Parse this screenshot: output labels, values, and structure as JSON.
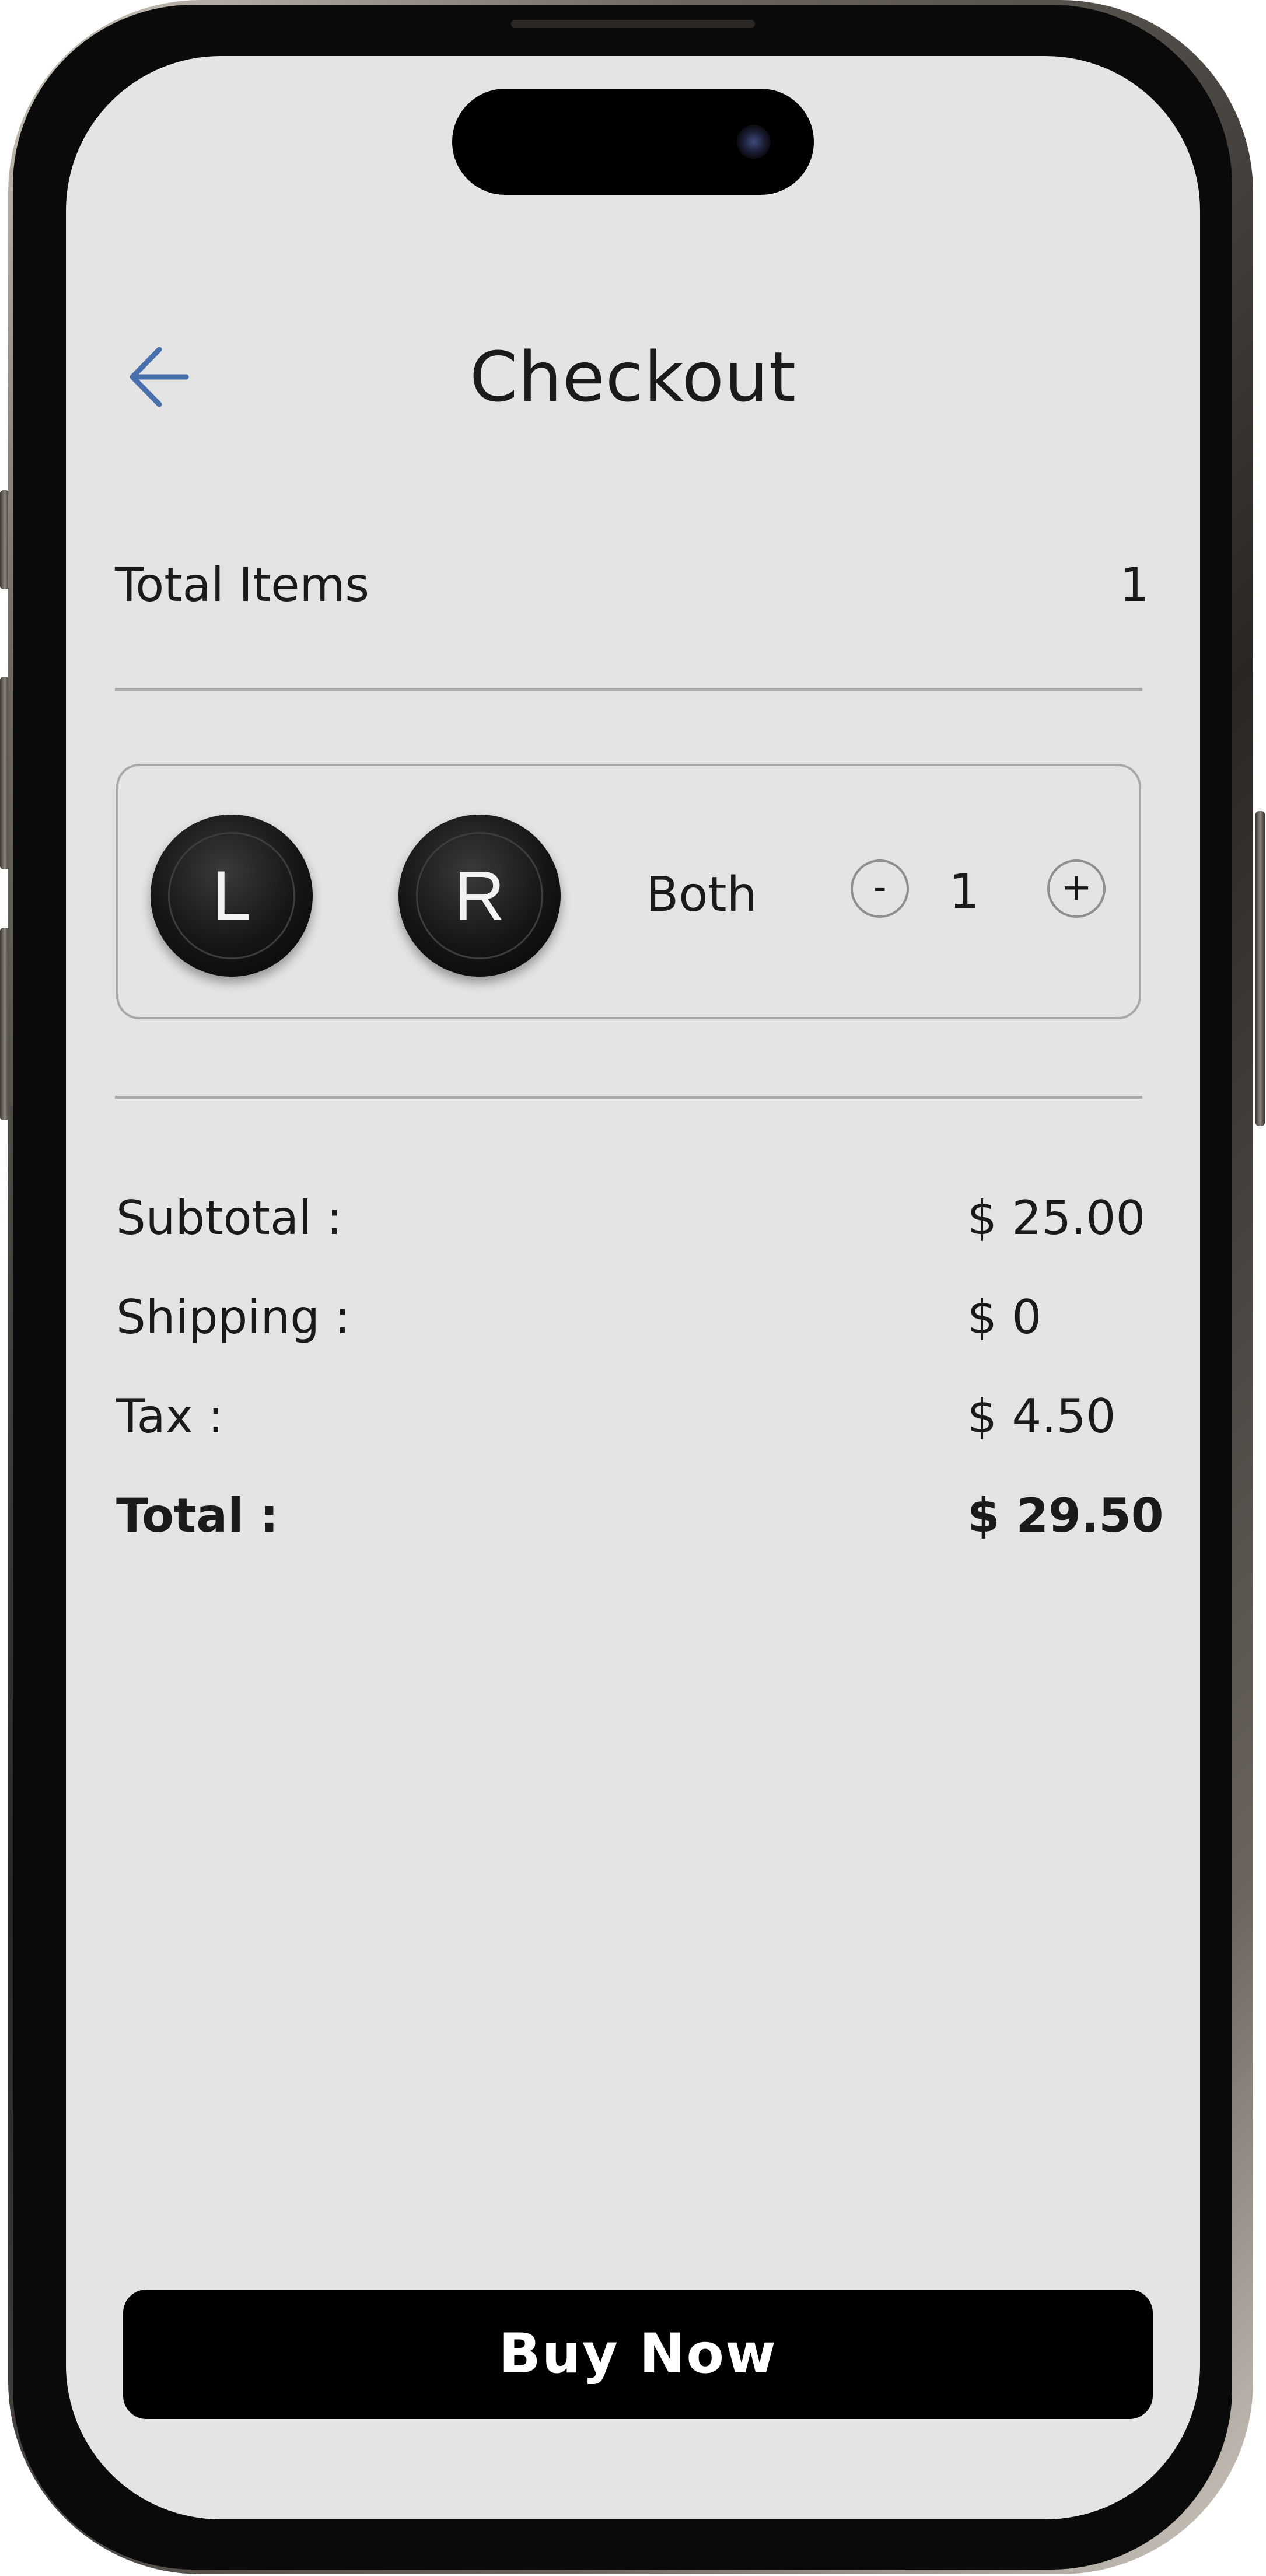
{
  "header": {
    "title": "Checkout",
    "back_icon": "arrow-left-icon"
  },
  "summary": {
    "total_items_label": "Total Items",
    "total_items_value": "1"
  },
  "product": {
    "left_label": "L",
    "right_label": "R",
    "variant": "Both",
    "quantity": "1",
    "minus_label": "-",
    "plus_label": "+"
  },
  "pricing": {
    "subtotal_label": "Subtotal :",
    "subtotal_value": "$ 25.00",
    "shipping_label": "Shipping :",
    "shipping_value": "$ 0",
    "tax_label": "Tax :",
    "tax_value": "$ 4.50",
    "total_label": "Total :",
    "total_value": "$ 29.50"
  },
  "actions": {
    "buy_label": "Buy Now"
  },
  "colors": {
    "accent": "#4a6fad",
    "screen_background": "#e4e4e4",
    "button_background": "#000000"
  }
}
